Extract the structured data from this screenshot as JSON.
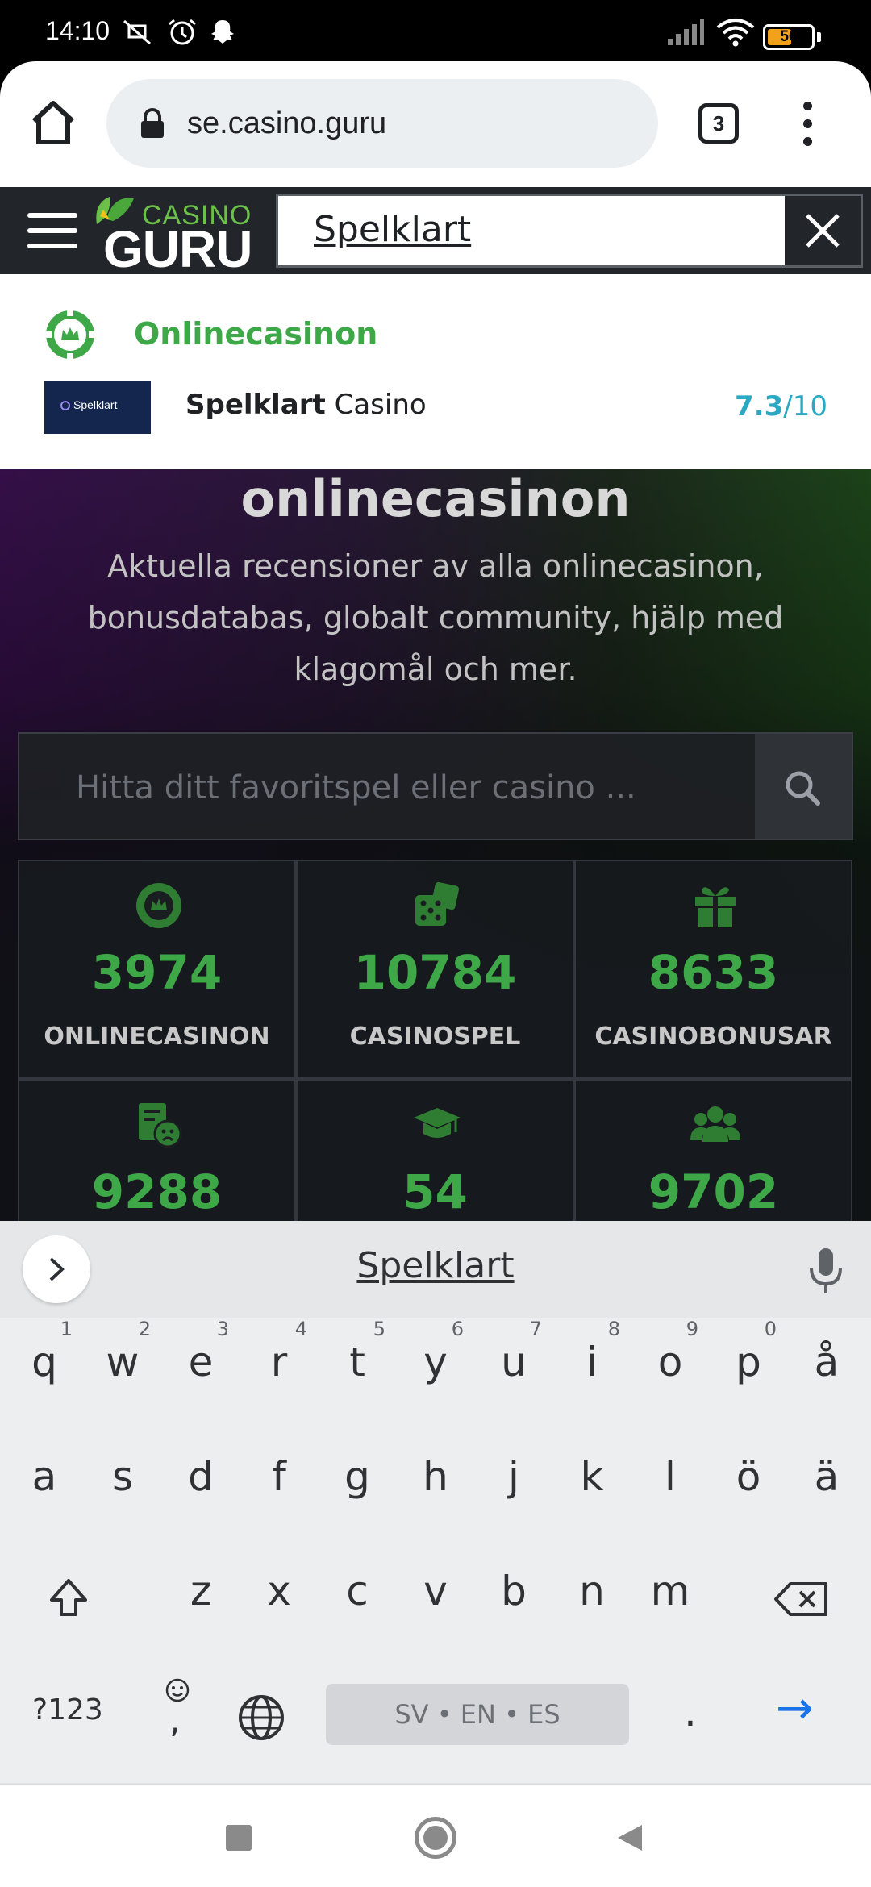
{
  "status_bar": {
    "time": "14:10",
    "battery_level": "56",
    "battery_fraction": 0.56,
    "icons": [
      "mute-vibrate-icon",
      "alarm-icon",
      "snapchat-icon",
      "signal-icon",
      "wifi-icon",
      "battery-icon"
    ]
  },
  "browser": {
    "url": "se.casino.guru",
    "tab_count": "3",
    "icons": [
      "home-icon",
      "lock-icon",
      "tabs-icon",
      "overflow-menu-icon"
    ]
  },
  "site_header": {
    "logo_top": "CASINO",
    "logo_bottom": "GURU",
    "search_value": "Spelklart",
    "icons": [
      "hamburger-icon",
      "close-icon"
    ]
  },
  "search_dropdown": {
    "category": "Onlinecasinon",
    "results": [
      {
        "logo_text": "Spelklart",
        "name_bold": "Spelklart",
        "name_rest": " Casino",
        "rating": "7.3",
        "rating_max": "/10"
      }
    ]
  },
  "hero": {
    "heading": "onlinecasinon",
    "subtitle": "Aktuella recensioner av alla onlinecasinon, bonusdatabas, globalt community, hjälp med klagomål och mer.",
    "search_placeholder": "Hitta ditt favoritspel eller casino ..."
  },
  "stats": [
    {
      "icon": "casino-chip-icon",
      "value": "3974",
      "label": "ONLINECASINON"
    },
    {
      "icon": "dice-icon",
      "value": "10784",
      "label": "CASINOSPEL"
    },
    {
      "icon": "gift-icon",
      "value": "8633",
      "label": "CASINOBONUSAR"
    },
    {
      "icon": "complaint-icon",
      "value": "9288",
      "label": ""
    },
    {
      "icon": "graduation-cap-icon",
      "value": "54",
      "label": ""
    },
    {
      "icon": "community-icon",
      "value": "9702",
      "label": ""
    }
  ],
  "keyboard": {
    "suggestion": "Spelklart",
    "row1": [
      {
        "char": "q",
        "hint": "1"
      },
      {
        "char": "w",
        "hint": "2"
      },
      {
        "char": "e",
        "hint": "3"
      },
      {
        "char": "r",
        "hint": "4"
      },
      {
        "char": "t",
        "hint": "5"
      },
      {
        "char": "y",
        "hint": "6"
      },
      {
        "char": "u",
        "hint": "7"
      },
      {
        "char": "i",
        "hint": "8"
      },
      {
        "char": "o",
        "hint": "9"
      },
      {
        "char": "p",
        "hint": "0"
      },
      {
        "char": "å",
        "hint": ""
      }
    ],
    "row2": [
      "a",
      "s",
      "d",
      "f",
      "g",
      "h",
      "j",
      "k",
      "l",
      "ö",
      "ä"
    ],
    "row3": [
      "z",
      "x",
      "c",
      "v",
      "b",
      "n",
      "m"
    ],
    "symbols_label": "?123",
    "emoji_label": ",",
    "space_label": "SV • EN • ES",
    "period_label": ".",
    "enter_label": "→"
  },
  "colors": {
    "brand_green": "#3ea747",
    "rating_blue": "#2aa9c5",
    "header_dark": "#22262a",
    "keyboard_bg": "#edeef0"
  }
}
